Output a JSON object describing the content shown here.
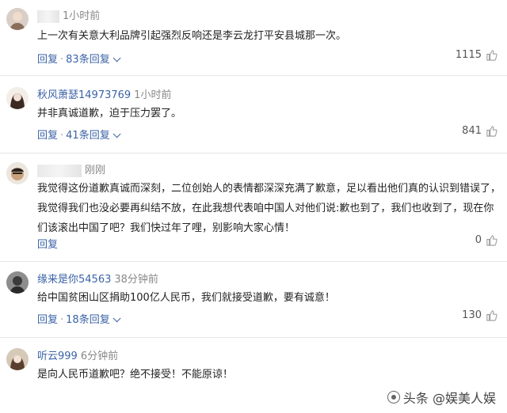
{
  "comments": [
    {
      "user": "",
      "time": "1小时前",
      "text": "上一次有关意大利品牌引起强烈反响还是李云龙打平安县城那一次。",
      "reply_label": "回复",
      "replies": "83条回复",
      "likes": "1115"
    },
    {
      "user": "秋风萧瑟14973769",
      "time": "1小时前",
      "text": "并非真诚道歉，迫于压力罢了。",
      "reply_label": "回复",
      "replies": "41条回复",
      "likes": "841"
    },
    {
      "user": "",
      "time": "刚刚",
      "text": "我觉得这份道歉真诚而深刻，二位创始人的表情都深深充满了歉意，足以看出他们真的认识到错误了，我觉得我们也没必要再纠结不放，在此我想代表咱中国人对他们说:歉也到了，我们也收到了，现在你们该滚出中国了吧？我们快过年了哩，别影响大家心情！",
      "reply_label": "回复",
      "likes": "0"
    },
    {
      "user": "缘来是你54563",
      "time": "38分钟前",
      "text": "给中国贫困山区捐助100亿人民币，我们就接受道歉，要有诚意！",
      "reply_label": "回复",
      "replies": "18条回复",
      "likes": "130"
    },
    {
      "user": "听云999",
      "time": "6分钟前",
      "text": "是向人民币道歉吧？绝不接受！不能原谅！"
    }
  ],
  "watermark": "头条 @娱美人娱",
  "colors": {
    "link": "#3b63a6",
    "muted": "#888888",
    "divider": "#e6e6e6"
  }
}
